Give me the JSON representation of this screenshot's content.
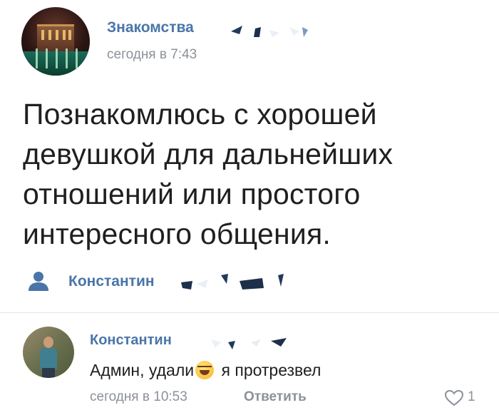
{
  "post": {
    "group_name": "Знакомства",
    "time": "сегодня в 7:43",
    "text": "Познакомлюсь с хорошей девушкой для дальнейших отношений или простого интересного общения.",
    "signer": "Константин"
  },
  "comment": {
    "author": "Константин",
    "text_before": "Админ, удали",
    "emoji": "rolling-on-floor-laughing",
    "text_after": "я протрезвел",
    "time": "сегодня в 10:53",
    "reply_label": "Ответить",
    "likes": "1"
  },
  "colors": {
    "link": "#4a75a8",
    "secondary": "#8c9199",
    "text": "#1f1f1f"
  }
}
